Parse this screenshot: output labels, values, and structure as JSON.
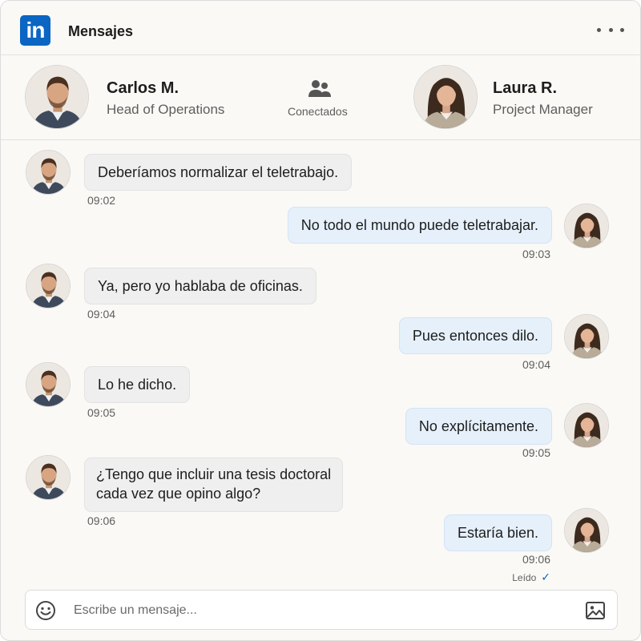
{
  "app": {
    "logo_text": "in",
    "title": "Mensajes",
    "brand_color": "#0a66c2"
  },
  "participants": {
    "left": {
      "name": "Carlos M.",
      "role": "Head of Operations"
    },
    "status": {
      "label": "Conectados",
      "icon": "people-icon"
    },
    "right": {
      "name": "Laura R.",
      "role": "Project Manager"
    }
  },
  "messages": [
    {
      "from": "Carlos M.",
      "text": "Deberíamos normalizar el teletrabajo.",
      "time": "09:02"
    },
    {
      "from": "Laura R.",
      "text": "No todo el mundo puede teletrabajar.",
      "time": "09:03"
    },
    {
      "from": "Carlos M.",
      "text": "Ya, pero yo hablaba de oficinas.",
      "time": "09:04"
    },
    {
      "from": "Laura R.",
      "text": "Pues entonces dilo.",
      "time": "09:04"
    },
    {
      "from": "Carlos M.",
      "text": "Lo he dicho.",
      "time": "09:05"
    },
    {
      "from": "Laura R.",
      "text": "No explícitamente.",
      "time": "09:05"
    },
    {
      "from": "Carlos M.",
      "text_line1": "¿Tengo que incluir una tesis doctoral",
      "text_line2": "cada vez que opino algo?",
      "time": "09:06"
    },
    {
      "from": "Laura R.",
      "text": "Estaría bien.",
      "time": "09:06"
    }
  ],
  "read_receipt": {
    "label": "Leído",
    "icon": "check-icon"
  },
  "composer": {
    "placeholder": "Escribe un mensaje...",
    "emoji_icon": "smiley-icon",
    "image_icon": "image-icon"
  }
}
